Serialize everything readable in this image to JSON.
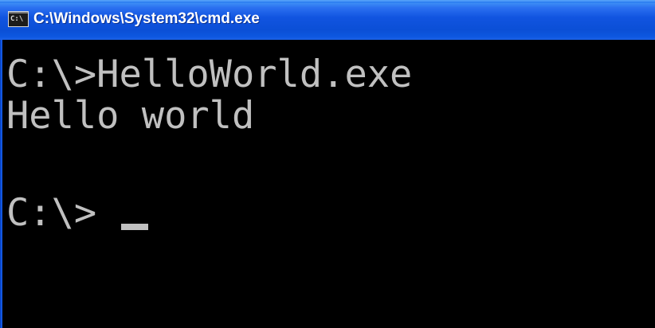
{
  "window": {
    "title": "C:\\Windows\\System32\\cmd.exe",
    "icon_text": "C:\\"
  },
  "console": {
    "lines": [
      "C:\\>HelloWorld.exe",
      "Hello world",
      "",
      "C:\\>"
    ]
  },
  "colors": {
    "titlebar": "#0b4fd6",
    "console_bg": "#000000",
    "console_fg": "#c0c0c0"
  },
  "icons": {
    "app": "cmd-app-icon"
  }
}
